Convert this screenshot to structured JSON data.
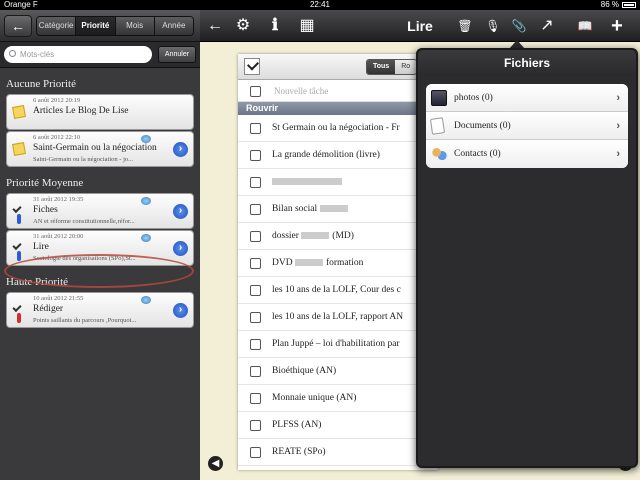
{
  "status": {
    "carrier": "Orange F",
    "time": "22:41",
    "battery": "86 %"
  },
  "sidebar": {
    "back_label": "←",
    "segments": [
      {
        "label": "Catégorie",
        "active": false
      },
      {
        "label": "Priorité",
        "active": true
      },
      {
        "label": "Mois",
        "active": false
      },
      {
        "label": "Année",
        "active": false
      }
    ],
    "search_placeholder": "Mots-clés",
    "cancel_label": "Annuler",
    "sections": [
      {
        "title": "Aucune Priorité",
        "cards": [
          {
            "date": "6 août 2012 20:19",
            "title": "Articles Le Blog De Lise",
            "sub": "",
            "icon": "note",
            "pin": "",
            "flag": false,
            "disclosure": false
          },
          {
            "date": "6 août 2012 22:10",
            "title": "Saint-Germain ou la négociation",
            "sub": "Saint-Germain ou la négociation   - jo...",
            "icon": "note",
            "pin": "",
            "flag": true,
            "disclosure": true
          }
        ]
      },
      {
        "title": "Priorité Moyenne",
        "cards": [
          {
            "date": "31 août 2012 19:35",
            "title": "Fiches",
            "sub": "AN et réforme constitutionnelle,réfor...",
            "icon": "check",
            "pin": "blue",
            "flag": true,
            "disclosure": true
          },
          {
            "date": "31 août 2012 20:00",
            "title": "Lire",
            "sub": "Sociologie des organisations (SPo),St...",
            "icon": "check",
            "pin": "blue",
            "flag": true,
            "disclosure": true
          }
        ]
      },
      {
        "title": "Haute Priorité",
        "cards": [
          {
            "date": "10 août 2012 21:55",
            "title": "Rédiger",
            "sub": "Points saillants du parcours ,Pourquoi...",
            "icon": "check",
            "pin": "red",
            "flag": true,
            "disclosure": true
          }
        ]
      }
    ]
  },
  "toolbar": {
    "title": "Lire",
    "icons": {
      "back": "←",
      "settings": "⚙",
      "info": "ℹ",
      "calculator": "▦",
      "trash": "🗑",
      "mic": "🎙",
      "attach": "📎",
      "share": "↗",
      "book": "📖",
      "add": "+"
    }
  },
  "tasks": {
    "filter": [
      {
        "label": "Tous",
        "on": true
      },
      {
        "label": "Ro",
        "on": false
      }
    ],
    "new_task_placeholder": "Nouvelle tâche",
    "group": "Rouvrir",
    "items": [
      "St Germain ou la négociation - Fr",
      "La grande démolition (livre)",
      "",
      "Bilan social ",
      "dossier ",
      "DVD ",
      "les 10 ans de la LOLF, Cour des c",
      "les 10 ans de la LOLF, rapport AN",
      "Plan Juppé – loi d'habilitation par",
      "Bioéthique (AN)",
      "Monnaie unique (AN)",
      "PLFSS (AN)",
      "REATE (SPo)"
    ],
    "item_suffixes": [
      "",
      "",
      "",
      "",
      "(MD)",
      "formation",
      "",
      "",
      "",
      "",
      "",
      "",
      ""
    ]
  },
  "popover": {
    "title": "Fichiers",
    "items": [
      {
        "label": "photos (0)",
        "icon": "photo"
      },
      {
        "label": "Documents (0)",
        "icon": "doc"
      },
      {
        "label": "Contacts (0)",
        "icon": "contact"
      }
    ]
  },
  "colors": {
    "accent_blue": "#1f4fc4",
    "highlight_red": "#b9463a",
    "paper_bg": "#f2efd6"
  }
}
